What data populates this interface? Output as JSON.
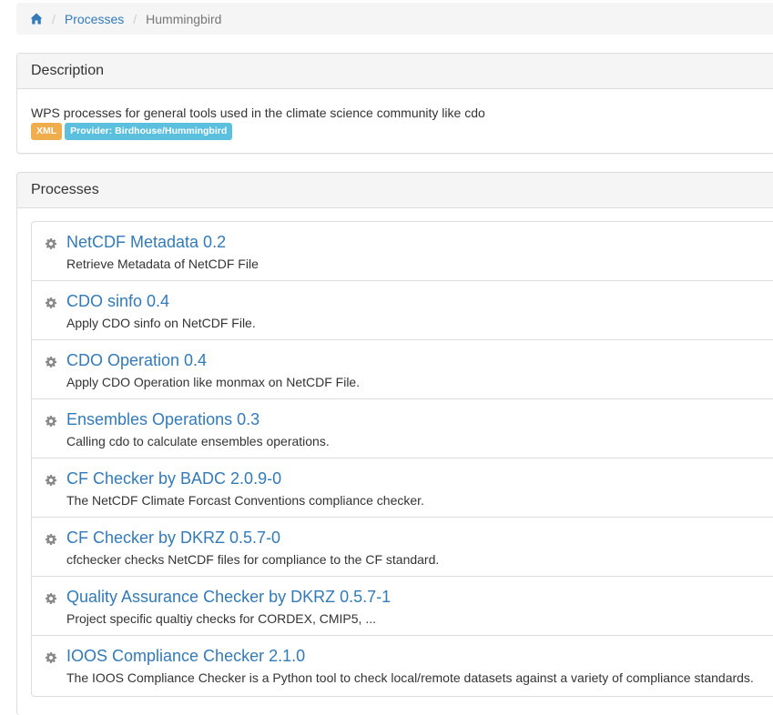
{
  "breadcrumb": {
    "home_icon": "home-icon",
    "items": [
      {
        "label": "Processes",
        "link": true
      },
      {
        "label": "Hummingbird",
        "link": false
      }
    ]
  },
  "description": {
    "heading": "Description",
    "text": "WPS processes for general tools used in the climate science community like cdo",
    "xml_label": "XML",
    "provider_label": "Provider: Birdhouse/Hummingbird"
  },
  "processes": {
    "heading": "Processes",
    "icon": "gear-icon",
    "items": [
      {
        "title": "NetCDF Metadata 0.2",
        "abstract": "Retrieve Metadata of NetCDF File"
      },
      {
        "title": "CDO sinfo 0.4",
        "abstract": "Apply CDO sinfo on NetCDF File."
      },
      {
        "title": "CDO Operation 0.4",
        "abstract": "Apply CDO Operation like monmax on NetCDF File."
      },
      {
        "title": "Ensembles Operations 0.3",
        "abstract": "Calling cdo to calculate ensembles operations."
      },
      {
        "title": "CF Checker by BADC 2.0.9-0",
        "abstract": "The NetCDF Climate Forcast Conventions compliance checker."
      },
      {
        "title": "CF Checker by DKRZ 0.5.7-0",
        "abstract": "cfchecker checks NetCDF files for compliance to the CF standard."
      },
      {
        "title": "Quality Assurance Checker by DKRZ 0.5.7-1",
        "abstract": "Project specific qualtiy checks for CORDEX, CMIP5, ..."
      },
      {
        "title": "IOOS Compliance Checker 2.1.0",
        "abstract": "The IOOS Compliance Checker is a Python tool to check local/remote datasets against a variety of compliance standards."
      }
    ]
  },
  "colors": {
    "link": "#337ab7",
    "label_warning": "#f0ad4e",
    "label_info": "#5bc0de",
    "panel_heading_bg": "#f5f5f5"
  }
}
